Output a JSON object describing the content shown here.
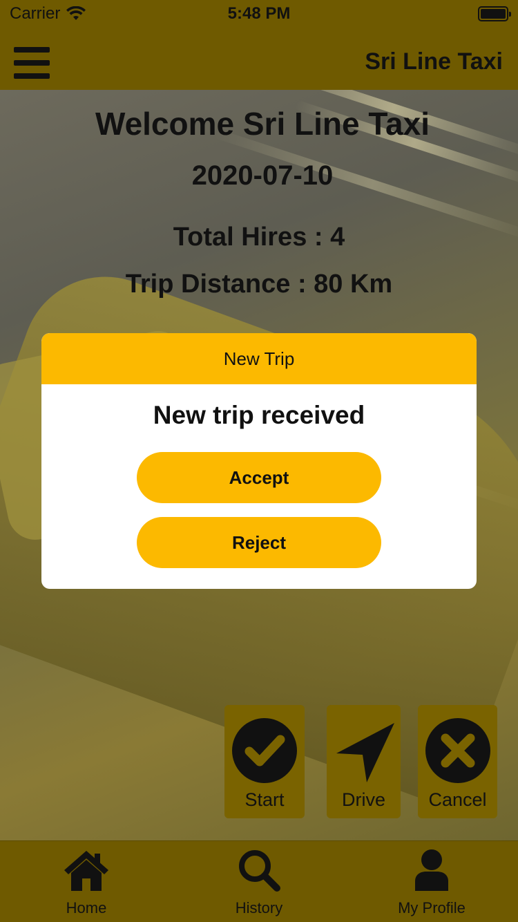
{
  "status_bar": {
    "carrier": "Carrier",
    "time": "5:48 PM"
  },
  "nav": {
    "title": "Sri Line Taxi",
    "menu_icon": "hamburger-menu-icon"
  },
  "dashboard": {
    "welcome": "Welcome Sri Line Taxi",
    "date": "2020-07-10",
    "total_hires": "Total Hires : 4",
    "trip_distance": "Trip Distance : 80 Km"
  },
  "modal": {
    "title": "New Trip",
    "message": "New trip received",
    "accept_label": "Accept",
    "reject_label": "Reject"
  },
  "actions": [
    {
      "label": "Start",
      "icon": "checkmark-circle-icon"
    },
    {
      "label": "Drive",
      "icon": "navigation-arrow-icon"
    },
    {
      "label": "Cancel",
      "icon": "close-circle-icon"
    }
  ],
  "tabs": [
    {
      "label": "Home",
      "icon": "home-icon"
    },
    {
      "label": "History",
      "icon": "search-icon"
    },
    {
      "label": "My Profile",
      "icon": "user-icon"
    }
  ],
  "colors": {
    "bar": "#6f5a00",
    "accent": "#fcb900",
    "action_bg": "#7a6300",
    "text": "#111111"
  }
}
